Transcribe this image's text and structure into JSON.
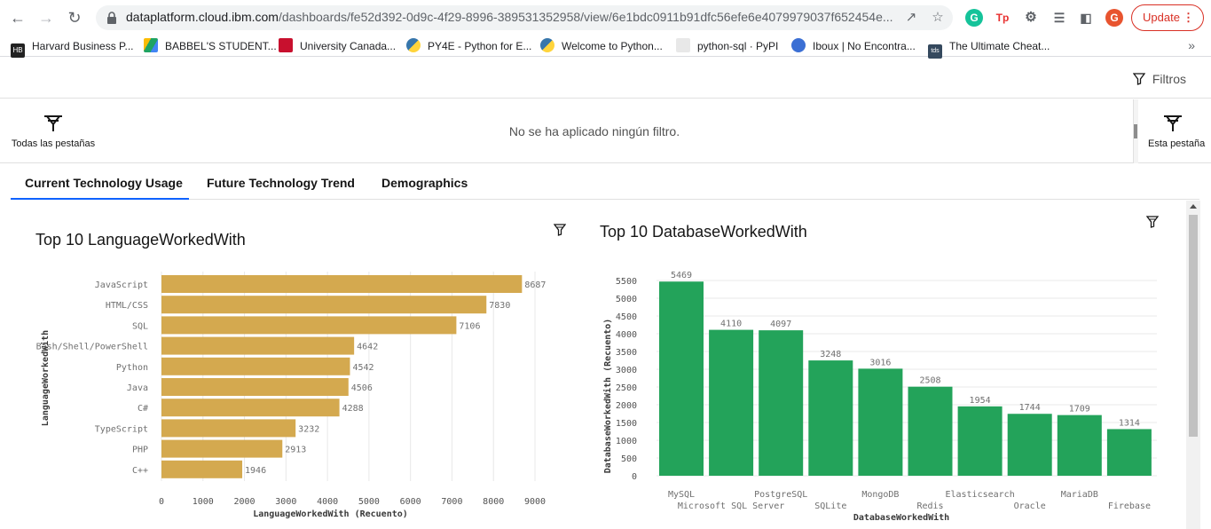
{
  "browser": {
    "url_host": "dataplatform.cloud.ibm.com",
    "url_path": "/dashboards/fe52d392-0d9c-4f29-8996-389531352958/view/6e1bdc0911b91dfc56efe6e4079979037f652454e...",
    "update_label": "Update",
    "profile_initial": "G",
    "bookmarks": [
      {
        "label": "Harvard Business P...",
        "icon": "hbr-icon",
        "color": "#222222"
      },
      {
        "label": "BABBEL'S STUDENT...",
        "icon": "drive-icon",
        "color": "#1fa463"
      },
      {
        "label": "University Canada...",
        "icon": "ucw-icon",
        "color": "#c8102e"
      },
      {
        "label": "PY4E - Python for E...",
        "icon": "python-icon",
        "color": "#3776ab"
      },
      {
        "label": "Welcome to Python...",
        "icon": "python-icon",
        "color": "#3776ab"
      },
      {
        "label": "python-sql · PyPI",
        "icon": "pypi-icon",
        "color": "#dddddd"
      },
      {
        "label": "Iboux | No Encontra...",
        "icon": "iboux-icon",
        "color": "#3b6fd4"
      },
      {
        "label": "The Ultimate Cheat...",
        "icon": "tds-icon",
        "color": "#35495e"
      }
    ]
  },
  "filters": {
    "button_label": "Filtros",
    "all_tabs_label": "Todas las pestañas",
    "empty_message": "No se ha aplicado ningún filtro.",
    "this_tab_label": "Esta pestaña"
  },
  "tabs": [
    {
      "label": "Current Technology Usage",
      "active": true
    },
    {
      "label": "Future Technology Trend",
      "active": false
    },
    {
      "label": "Demographics",
      "active": false
    }
  ],
  "chart_data": [
    {
      "type": "bar",
      "orientation": "horizontal",
      "title": "Top 10 LanguageWorkedWith",
      "xlabel": "LanguageWorkedWith (Recuento)",
      "ylabel": "LanguageWorkedWith",
      "categories": [
        "JavaScript",
        "HTML/CSS",
        "SQL",
        "Bash/Shell/PowerShell",
        "Python",
        "Java",
        "C#",
        "TypeScript",
        "PHP",
        "C++"
      ],
      "values": [
        8687,
        7830,
        7106,
        4642,
        4542,
        4506,
        4288,
        3232,
        2913,
        1946
      ],
      "xlim": [
        0,
        9000
      ],
      "ticks": [
        "0",
        "1000",
        "2000",
        "3000",
        "4000",
        "5000",
        "6000",
        "7000",
        "8000",
        "9000"
      ],
      "color": "#d4a94f",
      "grid": true
    },
    {
      "type": "bar",
      "orientation": "vertical",
      "title": "Top 10 DatabaseWorkedWith",
      "xlabel": "DatabaseWorkedWith",
      "ylabel": "DatabaseWorkedWith (Recuento)",
      "categories": [
        "MySQL",
        "Microsoft SQL Server",
        "PostgreSQL",
        "SQLite",
        "MongoDB",
        "Redis",
        "Elasticsearch",
        "Oracle",
        "MariaDB",
        "Firebase"
      ],
      "values": [
        5469,
        4110,
        4097,
        3248,
        3016,
        2508,
        1954,
        1744,
        1709,
        1314
      ],
      "ylim": [
        0,
        5500
      ],
      "ticks": [
        "0",
        "500",
        "1000",
        "1500",
        "2000",
        "2500",
        "3000",
        "3500",
        "4000",
        "4500",
        "5000",
        "5500"
      ],
      "color": "#23a35a",
      "grid": true
    }
  ]
}
